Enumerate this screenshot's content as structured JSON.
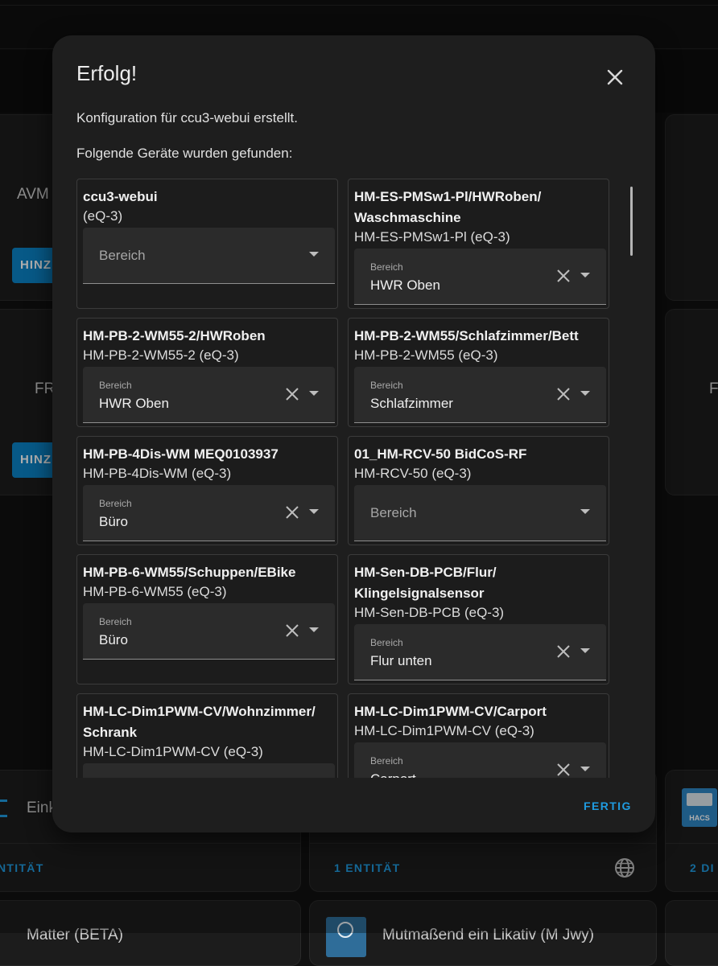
{
  "background": {
    "card_avm": "AVM",
    "card_fr_left": "FR",
    "card_f_right": "F",
    "add_button_1": "HINZ",
    "add_button_2": "HINZ",
    "integration_left": "Eink",
    "entity_link_left": "NTITÄT",
    "entity_link_middle": "1 ENTITÄT",
    "entity_link_right": "2 DI",
    "hacs_label": "HACS",
    "bottom_left_text": "Matter (BETA)",
    "bottom_middle_text": "Mutmaßend ein Likativ (M Jwy)"
  },
  "dialog": {
    "title": "Erfolg!",
    "line1": "Konfiguration für ccu3-webui erstellt.",
    "line2": "Folgende Geräte wurden gefunden:",
    "area_label": "Bereich",
    "done_button": "FERTIG",
    "devices": [
      {
        "name": "ccu3-webui",
        "model": "(eQ-3)",
        "area": ""
      },
      {
        "name": "HM-ES-PMSw1-Pl/HWRoben/ Waschmaschine",
        "model": "HM-ES-PMSw1-Pl (eQ-3)",
        "area": "HWR Oben"
      },
      {
        "name": "HM-PB-2-WM55-2/HWRoben",
        "model": "HM-PB-2-WM55-2 (eQ-3)",
        "area": "HWR Oben"
      },
      {
        "name": "HM-PB-2-WM55/Schlafzimmer/Bett",
        "model": "HM-PB-2-WM55 (eQ-3)",
        "area": "Schlafzimmer"
      },
      {
        "name": "HM-PB-4Dis-WM MEQ0103937",
        "model": "HM-PB-4Dis-WM (eQ-3)",
        "area": "Büro"
      },
      {
        "name": "01_HM-RCV-50 BidCoS-RF",
        "model": "HM-RCV-50 (eQ-3)",
        "area": ""
      },
      {
        "name": "HM-PB-6-WM55/Schuppen/EBike",
        "model": "HM-PB-6-WM55 (eQ-3)",
        "area": "Büro"
      },
      {
        "name": "HM-Sen-DB-PCB/Flur/ Klingelsignalsensor",
        "model": "HM-Sen-DB-PCB (eQ-3)",
        "area": "Flur unten"
      },
      {
        "name": "HM-LC-Dim1PWM-CV/Wohnzimmer/ Schrank",
        "model": "HM-LC-Dim1PWM-CV (eQ-3)",
        "area": ""
      },
      {
        "name": "HM-LC-Dim1PWM-CV/Carport",
        "model": "HM-LC-Dim1PWM-CV (eQ-3)",
        "area": "Carport"
      }
    ]
  }
}
